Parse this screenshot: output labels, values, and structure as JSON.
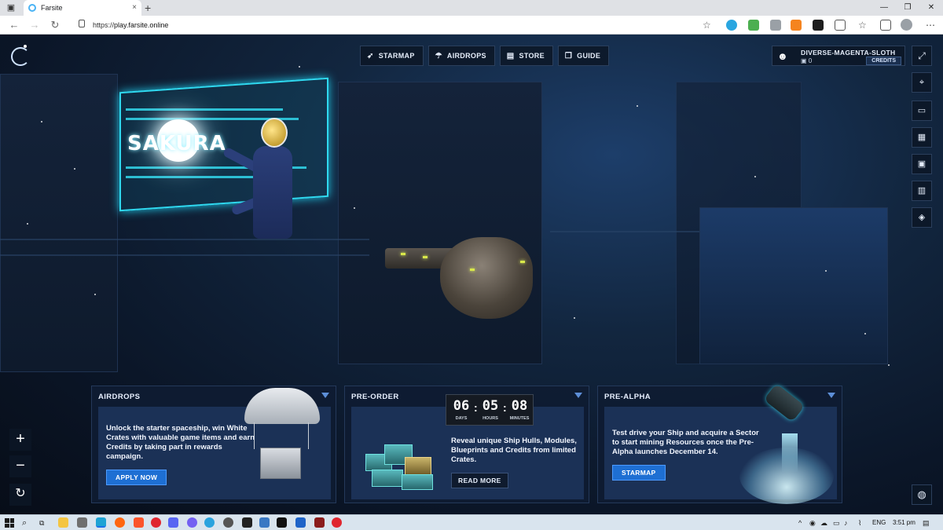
{
  "browser": {
    "tab_title": "Farsite",
    "url_scheme": "https://",
    "url_host": "play.farsite.online",
    "new_tab": "+",
    "close_tab": "×"
  },
  "game": {
    "nav": [
      {
        "label": "STARMAP",
        "icon": "rocket-icon"
      },
      {
        "label": "AIRDROPS",
        "icon": "parachute-icon"
      },
      {
        "label": "STORE",
        "icon": "store-icon"
      },
      {
        "label": "GUIDE",
        "icon": "book-icon"
      }
    ],
    "user": {
      "name": "DIVERSE-MAGENTA-SLOTH",
      "count": "0",
      "credits_label": "CREDITS"
    },
    "billboard_text": "SAKURA",
    "cards": {
      "airdrops": {
        "title": "AIRDROPS",
        "text": "Unlock the starter spaceship, win White Crates with valuable game items and earn Credits by taking part in rewards campaign.",
        "button": "APPLY NOW"
      },
      "preorder": {
        "title": "PRE-ORDER",
        "countdown": [
          {
            "value": "06",
            "label": "DAYS"
          },
          {
            "value": "05",
            "label": "HOURS"
          },
          {
            "value": "08",
            "label": "MINUTES"
          }
        ],
        "text": "Reveal unique Ship Hulls, Modules, Blueprints and Credits from limited Crates.",
        "button": "READ MORE"
      },
      "prealpha": {
        "title": "PRE-ALPHA",
        "text": "Test drive your Ship and acquire a Sector to start mining Resources once the Pre-Alpha launches December 14.",
        "button": "STARMAP"
      }
    },
    "zoom_in": "+",
    "zoom_out": "−",
    "colors": {
      "accent_blue": "#1e6fd3",
      "panel": "#1b3156",
      "billboard_cyan": "#2fd9f0"
    }
  },
  "taskbar": {
    "language": "ENG",
    "time": "3:51 pm"
  }
}
